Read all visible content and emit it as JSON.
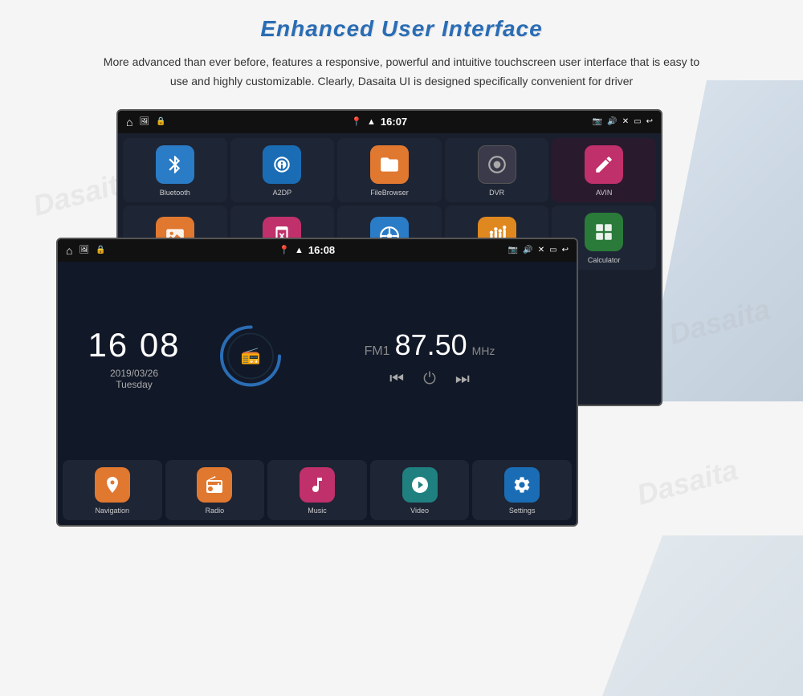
{
  "page": {
    "title": "Enhanced User Interface",
    "description": "More advanced than ever before, features a responsive, powerful and intuitive touchscreen user interface that is easy to use and highly customizable. Clearly, Dasaita UI is designed specifically convenient for driver"
  },
  "watermark": "Dasaita",
  "screen_back": {
    "status": {
      "time": "16:07",
      "left_icons": [
        "⌂",
        "🖼",
        "🔒"
      ],
      "right_icons": [
        "📷",
        "🔊",
        "✕",
        "▭",
        "↩"
      ]
    },
    "apps_row1": [
      {
        "label": "Bluetooth",
        "icon": "✱",
        "color": "blue"
      },
      {
        "label": "A2DP",
        "icon": "🎧",
        "color": "blue2"
      },
      {
        "label": "FileBrowser",
        "icon": "📁",
        "color": "orange"
      },
      {
        "label": "DVR",
        "icon": "⊙",
        "color": "gray"
      },
      {
        "label": "AVIN",
        "icon": "✏",
        "color": "pink"
      }
    ],
    "apps_row2": [
      {
        "label": "",
        "icon": "🖼",
        "color": "orange"
      },
      {
        "label": "",
        "icon": "⇄",
        "color": "pink"
      },
      {
        "label": "",
        "icon": "⊕",
        "color": "blue"
      },
      {
        "label": "",
        "icon": "⏤",
        "color": "amber"
      },
      {
        "label": "Calculator",
        "icon": "▦",
        "color": "green"
      }
    ]
  },
  "screen_front": {
    "status": {
      "time": "16:08",
      "left_icons": [
        "⌂",
        "🖼",
        "🔒"
      ],
      "right_icons": [
        "📷",
        "🔊",
        "✕",
        "▭",
        "↩"
      ]
    },
    "clock": {
      "time": "16 08",
      "date": "2019/03/26",
      "day": "Tuesday"
    },
    "radio": {
      "band": "FM1",
      "frequency": "87.50",
      "unit": "MHz",
      "icon": "📻"
    },
    "bottom_apps": [
      {
        "label": "Navigation",
        "icon": "📍",
        "color": "orange"
      },
      {
        "label": "Radio",
        "icon": "📻",
        "color": "orange"
      },
      {
        "label": "Music",
        "icon": "♪",
        "color": "pink"
      },
      {
        "label": "Video",
        "icon": "▶",
        "color": "teal"
      },
      {
        "label": "Settings",
        "icon": "⚙",
        "color": "blue2"
      }
    ]
  }
}
